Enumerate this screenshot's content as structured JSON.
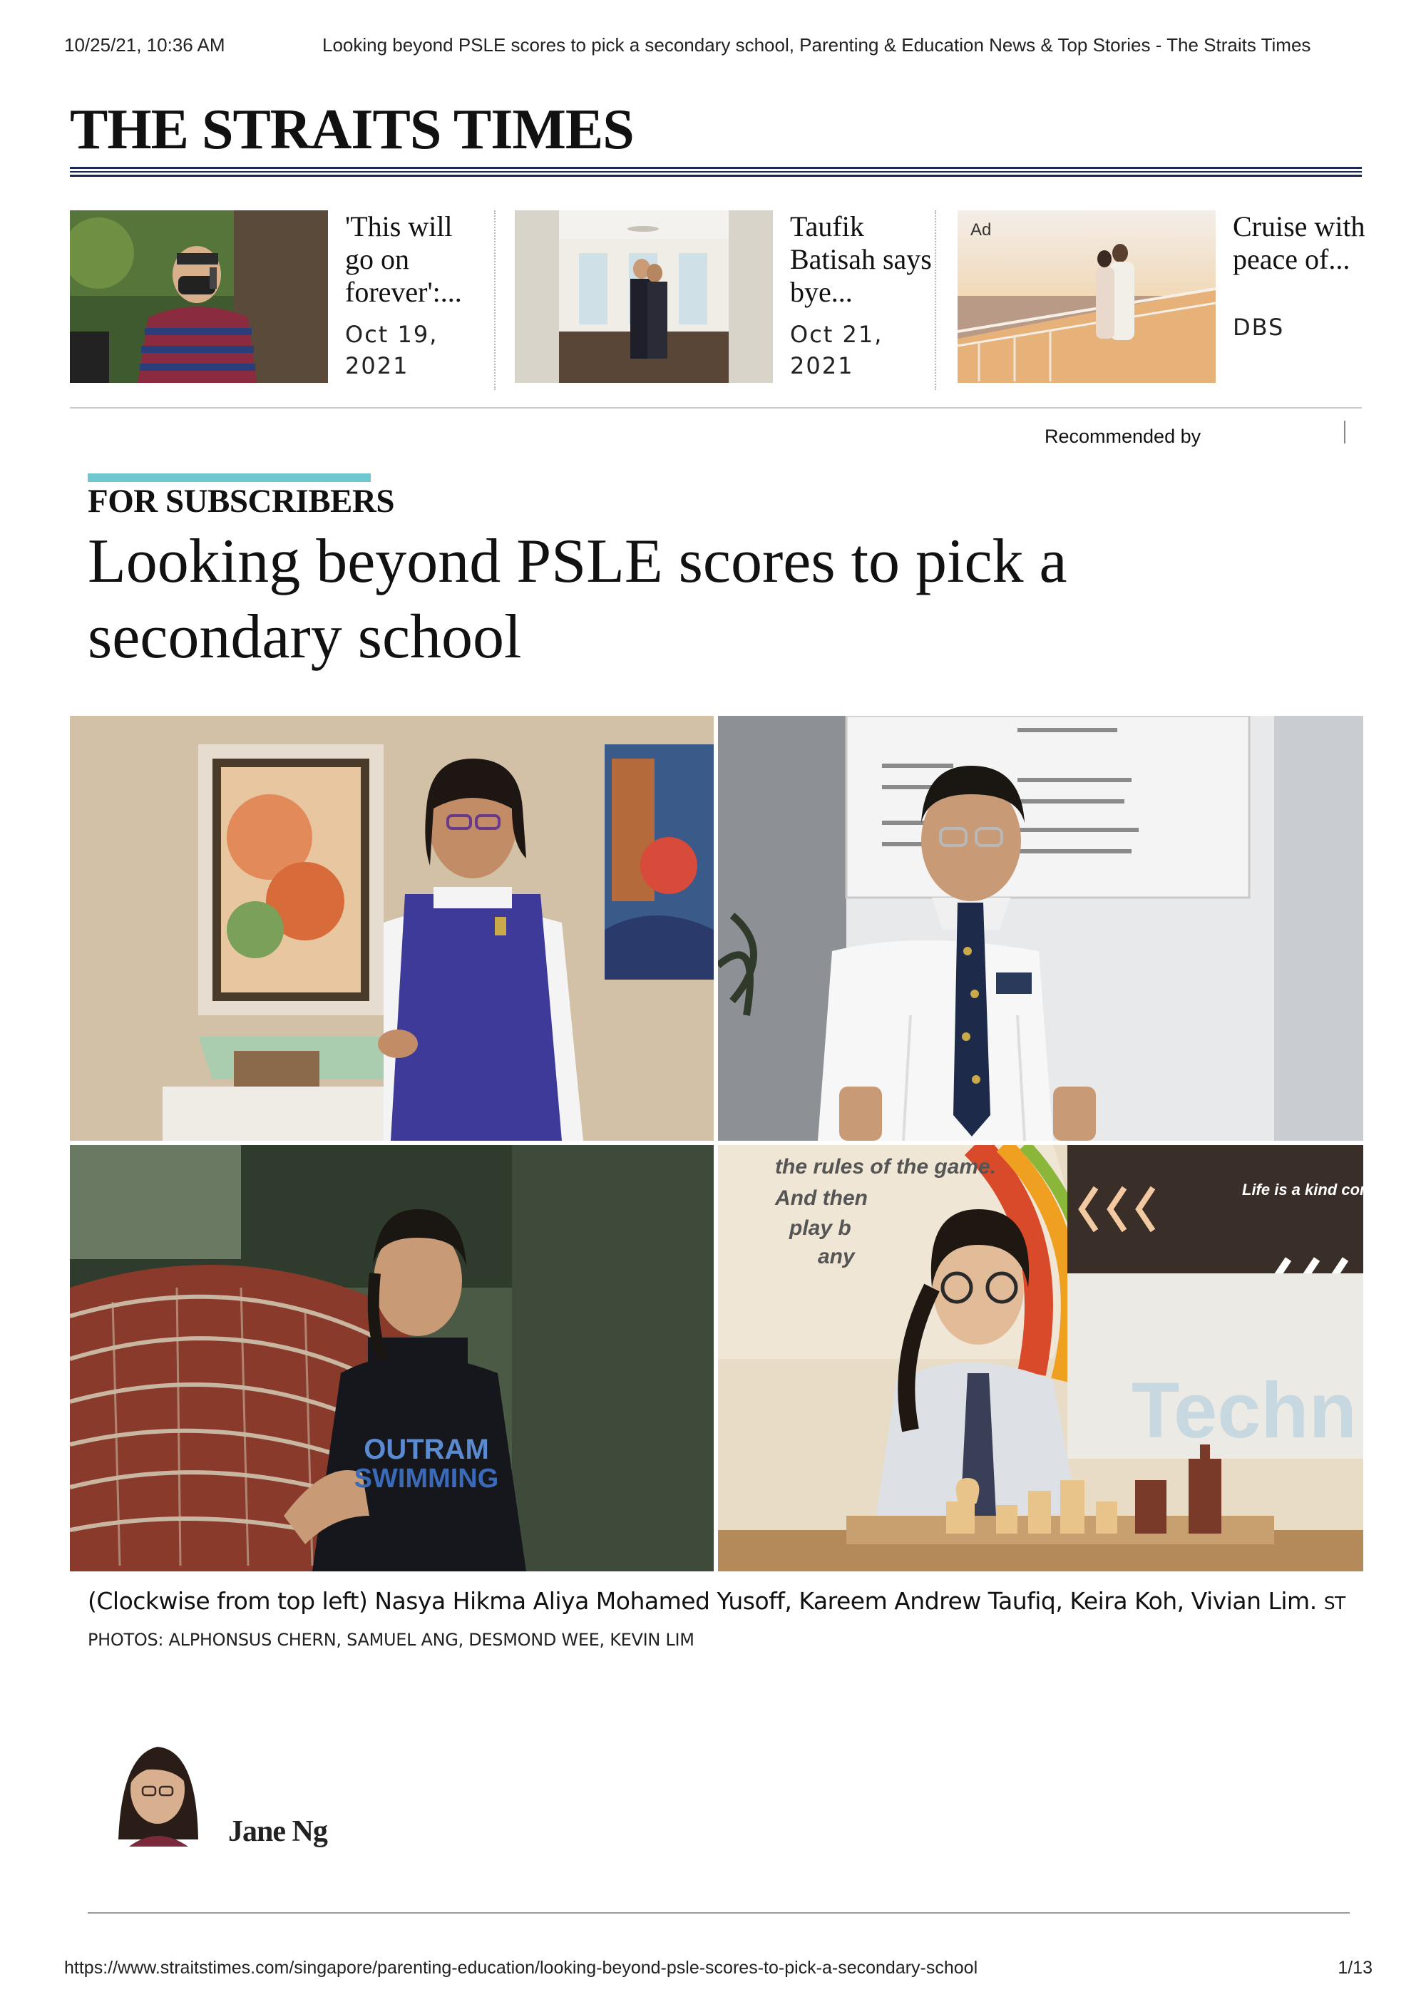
{
  "print_header": {
    "datetime": "10/25/21, 10:36 AM",
    "doc_title": "Looking beyond PSLE scores to pick a secondary school, Parenting & Education News & Top Stories - The Straits Times"
  },
  "masthead": {
    "logo": "THE STRAITS TIMES"
  },
  "recommendations": [
    {
      "headline": "'This will go on forever':...",
      "date_line1": "Oct 19,",
      "date_line2": "2021"
    },
    {
      "headline": "Taufik Batisah says bye...",
      "date_line1": "Oct 21,",
      "date_line2": "2021"
    },
    {
      "ad_label": "Ad",
      "headline": "Cruise with peace of...",
      "sponsor": "DBS"
    }
  ],
  "recommended_by": "Recommended by",
  "article": {
    "kicker": "FOR SUBSCRIBERS",
    "title": "Looking beyond PSLE scores to pick a secondary school",
    "photo_texts": {
      "shirt_text_1": "OUTRAM",
      "shirt_text_2": "SWIMMING",
      "wall_text_1": "the rules of the game.",
      "wall_text_2": "And then",
      "wall_text_3": "play b",
      "wall_text_4": "any",
      "sign_text": "Life is a kind competition",
      "banner_text": "Techn"
    },
    "caption": "(Clockwise from top left) Nasya Hikma Aliya Mohamed Yusoff, Kareem Andrew Taufiq, Keira Koh, Vivian Lim.",
    "caption_credit": "ST",
    "photo_credit": "PHOTOS: ALPHONSUS CHERN, SAMUEL ANG, DESMOND WEE, KEVIN LIM",
    "author": "Jane Ng"
  },
  "print_footer": {
    "url": "https://www.straitstimes.com/singapore/parenting-education/looking-beyond-psle-scores-to-pick-a-secondary-school",
    "page": "1/13"
  }
}
